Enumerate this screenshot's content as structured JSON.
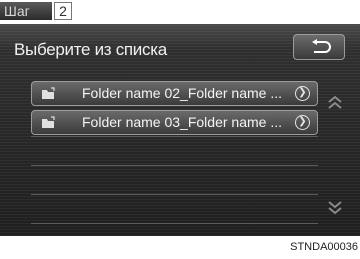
{
  "step": {
    "label": "Шаг",
    "number": "2"
  },
  "screen": {
    "title": "Выберите из списка",
    "back_icon": "return-arrow-icon",
    "items": [
      {
        "label": "Folder name 02_Folder name ...",
        "icon": "folder-icon",
        "go_icon": "chevron-right-circle-icon"
      },
      {
        "label": "Folder name 03_Folder name ...",
        "icon": "folder-icon",
        "go_icon": "chevron-right-circle-icon"
      }
    ],
    "scroll_up_icon": "double-chevron-up-icon",
    "scroll_down_icon": "double-chevron-down-icon"
  },
  "caption": "STNDA00036"
}
